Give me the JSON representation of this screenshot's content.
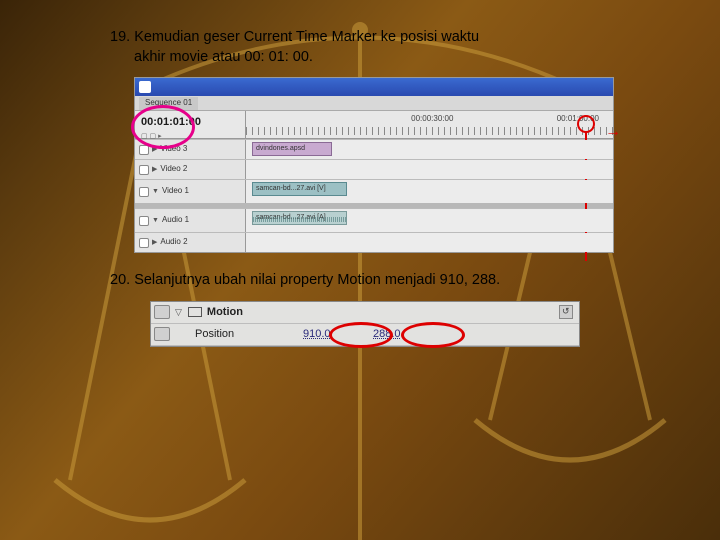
{
  "steps": {
    "s19": {
      "num": "19. ",
      "text_a": "Kemudian geser Current Time Marker ke posisi waktu",
      "text_b": "akhir movie atau 00: 01: 00."
    },
    "s20": {
      "num": "20. ",
      "text": "Selanjutnya ubah nilai property Motion menjadi 910, 288."
    }
  },
  "timeline": {
    "timecode": "00:01:01:00",
    "ruler_mid": "00:00:30:00",
    "ruler_end": "00:01:00:00",
    "sequence_tab": "Sequence 01",
    "tracks": {
      "video3": "Video 3",
      "video2": "Video 2",
      "video1": "Video 1",
      "audio1": "Audio 1",
      "audio2": "Audio 2"
    },
    "clips": {
      "v3": "dvindones.apsd",
      "v1": "samcan-bd...27.avi [V]",
      "a1": "samcan-bd...27.avi [A]"
    }
  },
  "motion": {
    "label": "Motion",
    "position_label": "Position",
    "x": "910.0",
    "y": "288.0"
  }
}
